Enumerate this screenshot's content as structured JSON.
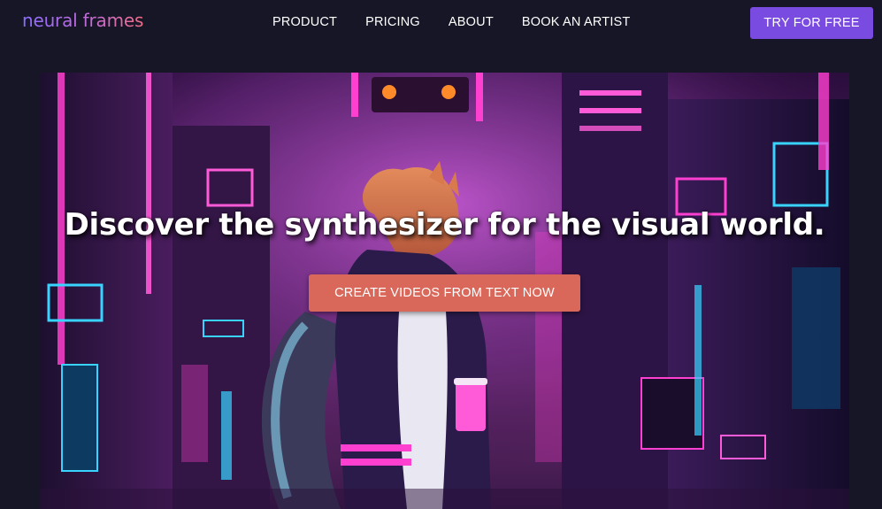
{
  "brand": {
    "name": "neural frames"
  },
  "nav": {
    "items": [
      {
        "label": "PRODUCT"
      },
      {
        "label": "PRICING"
      },
      {
        "label": "ABOUT"
      },
      {
        "label": "BOOK AN ARTIST"
      }
    ],
    "cta_label": "TRY FOR FREE"
  },
  "hero": {
    "headline": "Discover the synthesizer for the visual world.",
    "cta_label": "CREATE VIDEOS FROM TEXT NOW",
    "image": "neon-cyberpunk-city-squirrel-illustration"
  },
  "colors": {
    "page_background": "#161627",
    "nav_cta": "#7a4be0",
    "hero_cta": "#d9685a",
    "neon_pink": "#ff3fd0",
    "neon_cyan": "#38d4ff"
  }
}
